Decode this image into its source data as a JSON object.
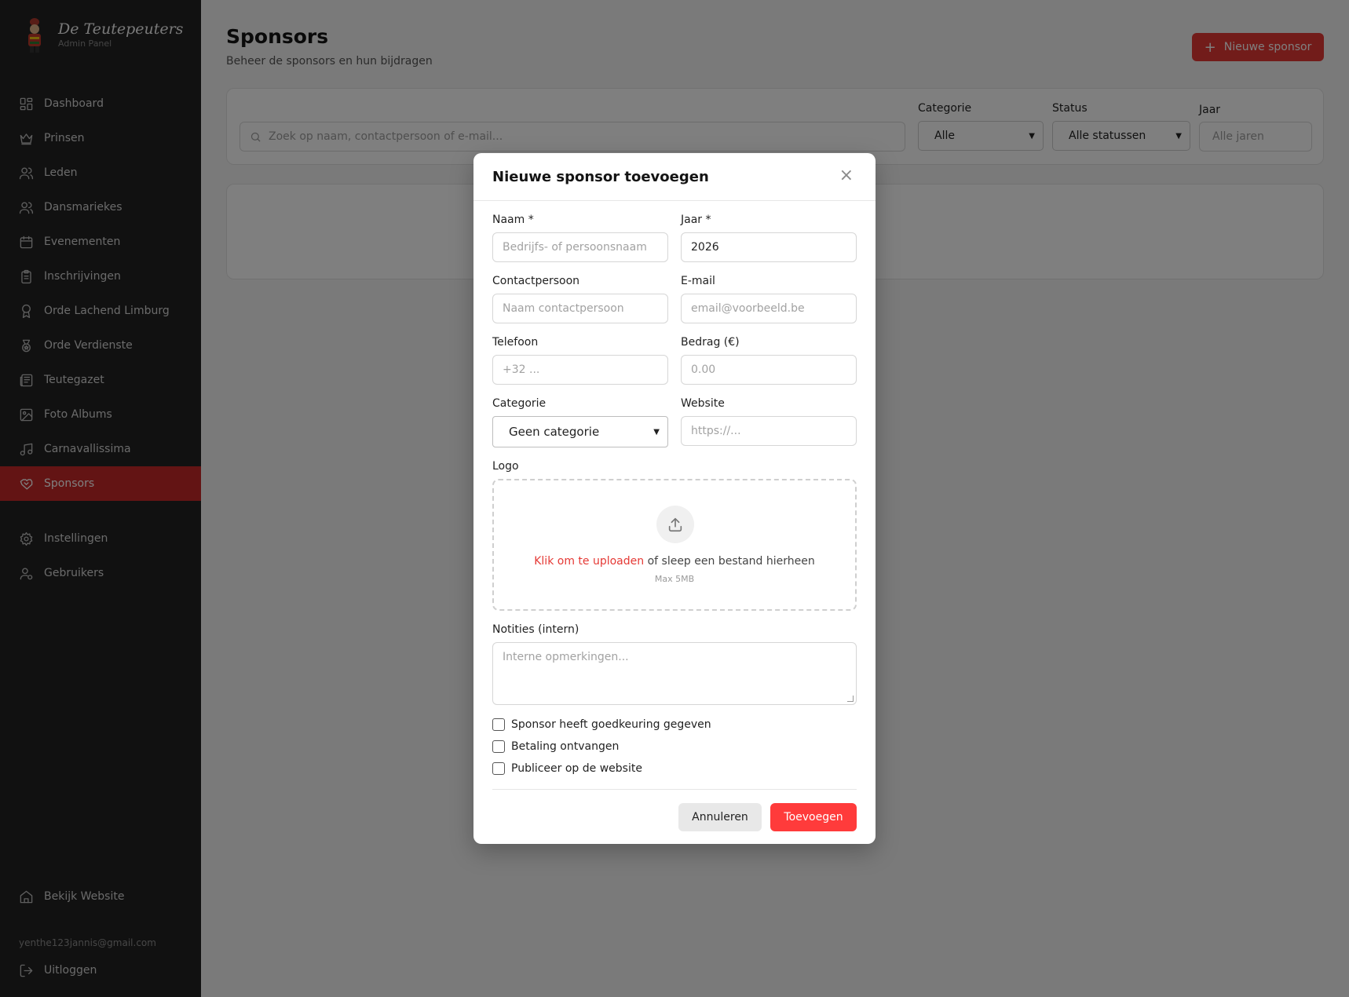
{
  "brand": {
    "title": "De Teutepeuters",
    "subtitle": "Admin Panel"
  },
  "sidebar": {
    "items": [
      {
        "label": "Dashboard",
        "icon": "dashboard-icon"
      },
      {
        "label": "Prinsen",
        "icon": "crown-icon"
      },
      {
        "label": "Leden",
        "icon": "users-icon"
      },
      {
        "label": "Dansmariekes",
        "icon": "users-icon"
      },
      {
        "label": "Evenementen",
        "icon": "calendar-icon"
      },
      {
        "label": "Inschrijvingen",
        "icon": "clipboard-icon"
      },
      {
        "label": "Orde Lachend Limburg",
        "icon": "award-icon"
      },
      {
        "label": "Orde Verdienste",
        "icon": "medal-icon"
      },
      {
        "label": "Teutegazet",
        "icon": "newspaper-icon"
      },
      {
        "label": "Foto Albums",
        "icon": "image-icon"
      },
      {
        "label": "Carnavallissima",
        "icon": "music-icon"
      },
      {
        "label": "Sponsors",
        "icon": "handshake-icon",
        "active": true
      },
      {
        "label": "Instellingen",
        "icon": "gear-icon"
      },
      {
        "label": "Gebruikers",
        "icon": "user-cog-icon"
      }
    ],
    "view_site": "Bekijk Website",
    "user_email": "yenthe123jannis@gmail.com",
    "logout": "Uitloggen"
  },
  "header": {
    "title": "Sponsors",
    "subtitle": "Beheer de sponsors en hun bijdragen",
    "new_button": "Nieuwe sponsor"
  },
  "filters": {
    "search_placeholder": "Zoek op naam, contactpersoon of e-mail...",
    "category_label": "Categorie",
    "category_value": "Alle",
    "status_label": "Status",
    "status_value": "Alle statussen",
    "year_label": "Jaar",
    "year_placeholder": "Alle jaren"
  },
  "modal": {
    "title": "Nieuwe sponsor toevoegen",
    "close": "×",
    "name_label": "Naam *",
    "name_placeholder": "Bedrijfs- of persoonsnaam",
    "year_label": "Jaar *",
    "year_value": "2026",
    "contact_label": "Contactpersoon",
    "contact_placeholder": "Naam contactpersoon",
    "email_label": "E-mail",
    "email_placeholder": "email@voorbeeld.be",
    "phone_label": "Telefoon",
    "phone_placeholder": "+32 ...",
    "amount_label": "Bedrag (€)",
    "amount_placeholder": "0.00",
    "category_label": "Categorie",
    "category_value": "Geen categorie",
    "website_label": "Website",
    "website_placeholder": "https://...",
    "logo_label": "Logo",
    "upload_link": "Klik om te uploaden",
    "upload_rest": " of sleep een bestand hierheen",
    "upload_max": "Max 5MB",
    "notes_label": "Notities (intern)",
    "notes_placeholder": "Interne opmerkingen...",
    "checkboxes": [
      "Sponsor heeft goedkeuring gegeven",
      "Betaling ontvangen",
      "Publiceer op de website"
    ],
    "cancel": "Annuleren",
    "submit": "Toevoegen"
  },
  "colors": {
    "accent": "#e53935",
    "sidebar_bg": "#232323",
    "active_item": "#c62828"
  }
}
